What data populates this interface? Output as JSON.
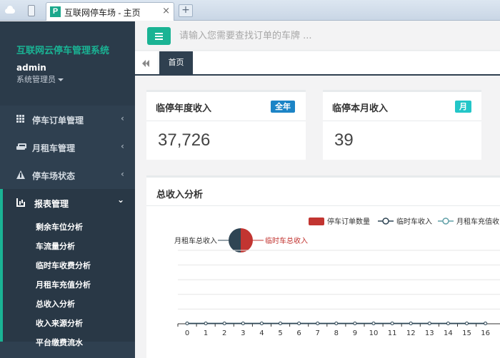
{
  "browser": {
    "tab_title": "互联网停车场 - 主页",
    "favicon_letter": "P",
    "close_symbol": "×",
    "new_tab_symbol": "+"
  },
  "sidebar": {
    "brand": "互联网云停车管理系统",
    "username": "admin",
    "role": "系统管理员",
    "items": [
      {
        "label": "停车订单管理",
        "icon": "grid-icon",
        "chevron": "‹"
      },
      {
        "label": "月租车管理",
        "icon": "car-icon",
        "chevron": "‹"
      },
      {
        "label": "停车场状态",
        "icon": "road-icon",
        "chevron": "‹"
      },
      {
        "label": "报表管理",
        "icon": "bar-chart-icon",
        "chevron": "⌄"
      }
    ],
    "sub_items": [
      "剩余车位分析",
      "车流量分析",
      "临时车收费分析",
      "月租车充值分析",
      "总收入分析",
      "收入来源分析",
      "平台缴费流水"
    ]
  },
  "header": {
    "search_placeholder": "请输入您需要查找订单的车牌 ..."
  },
  "tabs": {
    "home": "首页"
  },
  "cards": [
    {
      "title": "临停年度收入",
      "badge": "全年",
      "badge_color": "#1c84c6",
      "value": "37,726"
    },
    {
      "title": "临停本月收入",
      "badge": "月",
      "badge_color": "#23c6c8",
      "value": "39"
    }
  ],
  "chart": {
    "title": "总收入分析"
  },
  "chart_data": {
    "type": "line",
    "title": "总收入分析",
    "legend_position": "top-right",
    "series": [
      {
        "name": "停车订单数量",
        "kind": "bar",
        "color": "#c23531",
        "values": [
          0,
          0,
          0,
          0,
          0,
          0,
          0,
          0,
          0,
          0,
          0,
          0,
          0,
          0,
          0,
          0,
          0
        ]
      },
      {
        "name": "临时车收入",
        "kind": "line",
        "color": "#2f4554",
        "values": [
          0,
          0,
          0,
          0,
          0,
          0,
          0,
          0,
          0,
          0,
          0,
          0,
          0,
          0,
          0,
          0,
          0
        ]
      },
      {
        "name": "月租车充值收",
        "kind": "line",
        "color": "#61a0a8",
        "values": [
          0,
          0,
          0,
          0,
          0,
          0,
          0,
          0,
          0,
          0,
          0,
          0,
          0,
          0,
          0,
          0,
          0
        ]
      }
    ],
    "x": [
      "0",
      "1",
      "2",
      "3",
      "4",
      "5",
      "6",
      "7",
      "8",
      "9",
      "10",
      "11",
      "12",
      "13",
      "14",
      "15",
      "16"
    ],
    "pie": {
      "slices": [
        {
          "label": "月租车总收入",
          "color": "#2f4554",
          "value": 50
        },
        {
          "label": "临时车总收入",
          "color": "#c23531",
          "value": 50
        }
      ]
    }
  }
}
